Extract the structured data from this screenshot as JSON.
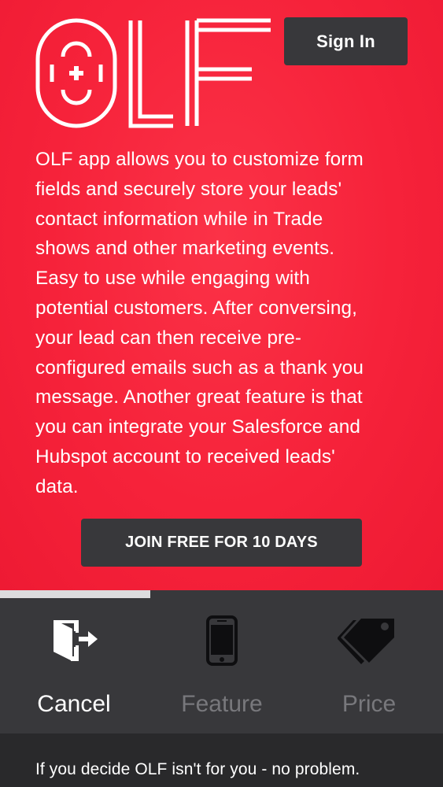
{
  "header": {
    "logo_text": "OLF",
    "sign_in_label": "Sign In"
  },
  "description_lines": [
    "OLF app allows you to customize form",
    "fields and securely store your leads'",
    "contact information while in Trade",
    "shows and other marketing events.",
    "Easy to use while engaging with",
    "potential customers. After conversing,",
    "your lead can then receive pre-",
    "configured emails such as a thank you",
    "message. Another great feature is that",
    "you can integrate your Salesforce and",
    "Hubspot account to received leads'",
    "data."
  ],
  "cta": {
    "join_label": "JOIN FREE FOR 10 DAYS"
  },
  "progress": {
    "fraction": 0.34
  },
  "tabs": [
    {
      "label": "Cancel",
      "icon": "exit-door-icon",
      "active": true
    },
    {
      "label": "Feature",
      "icon": "smartphone-icon",
      "active": false
    },
    {
      "label": "Price",
      "icon": "price-tags-icon",
      "active": false
    }
  ],
  "footer": {
    "text": "If you decide OLF isn't for you - no problem."
  },
  "colors": {
    "background_red": "#f6223a",
    "button_dark": "#38383b",
    "tab_inactive": "#78787c"
  }
}
